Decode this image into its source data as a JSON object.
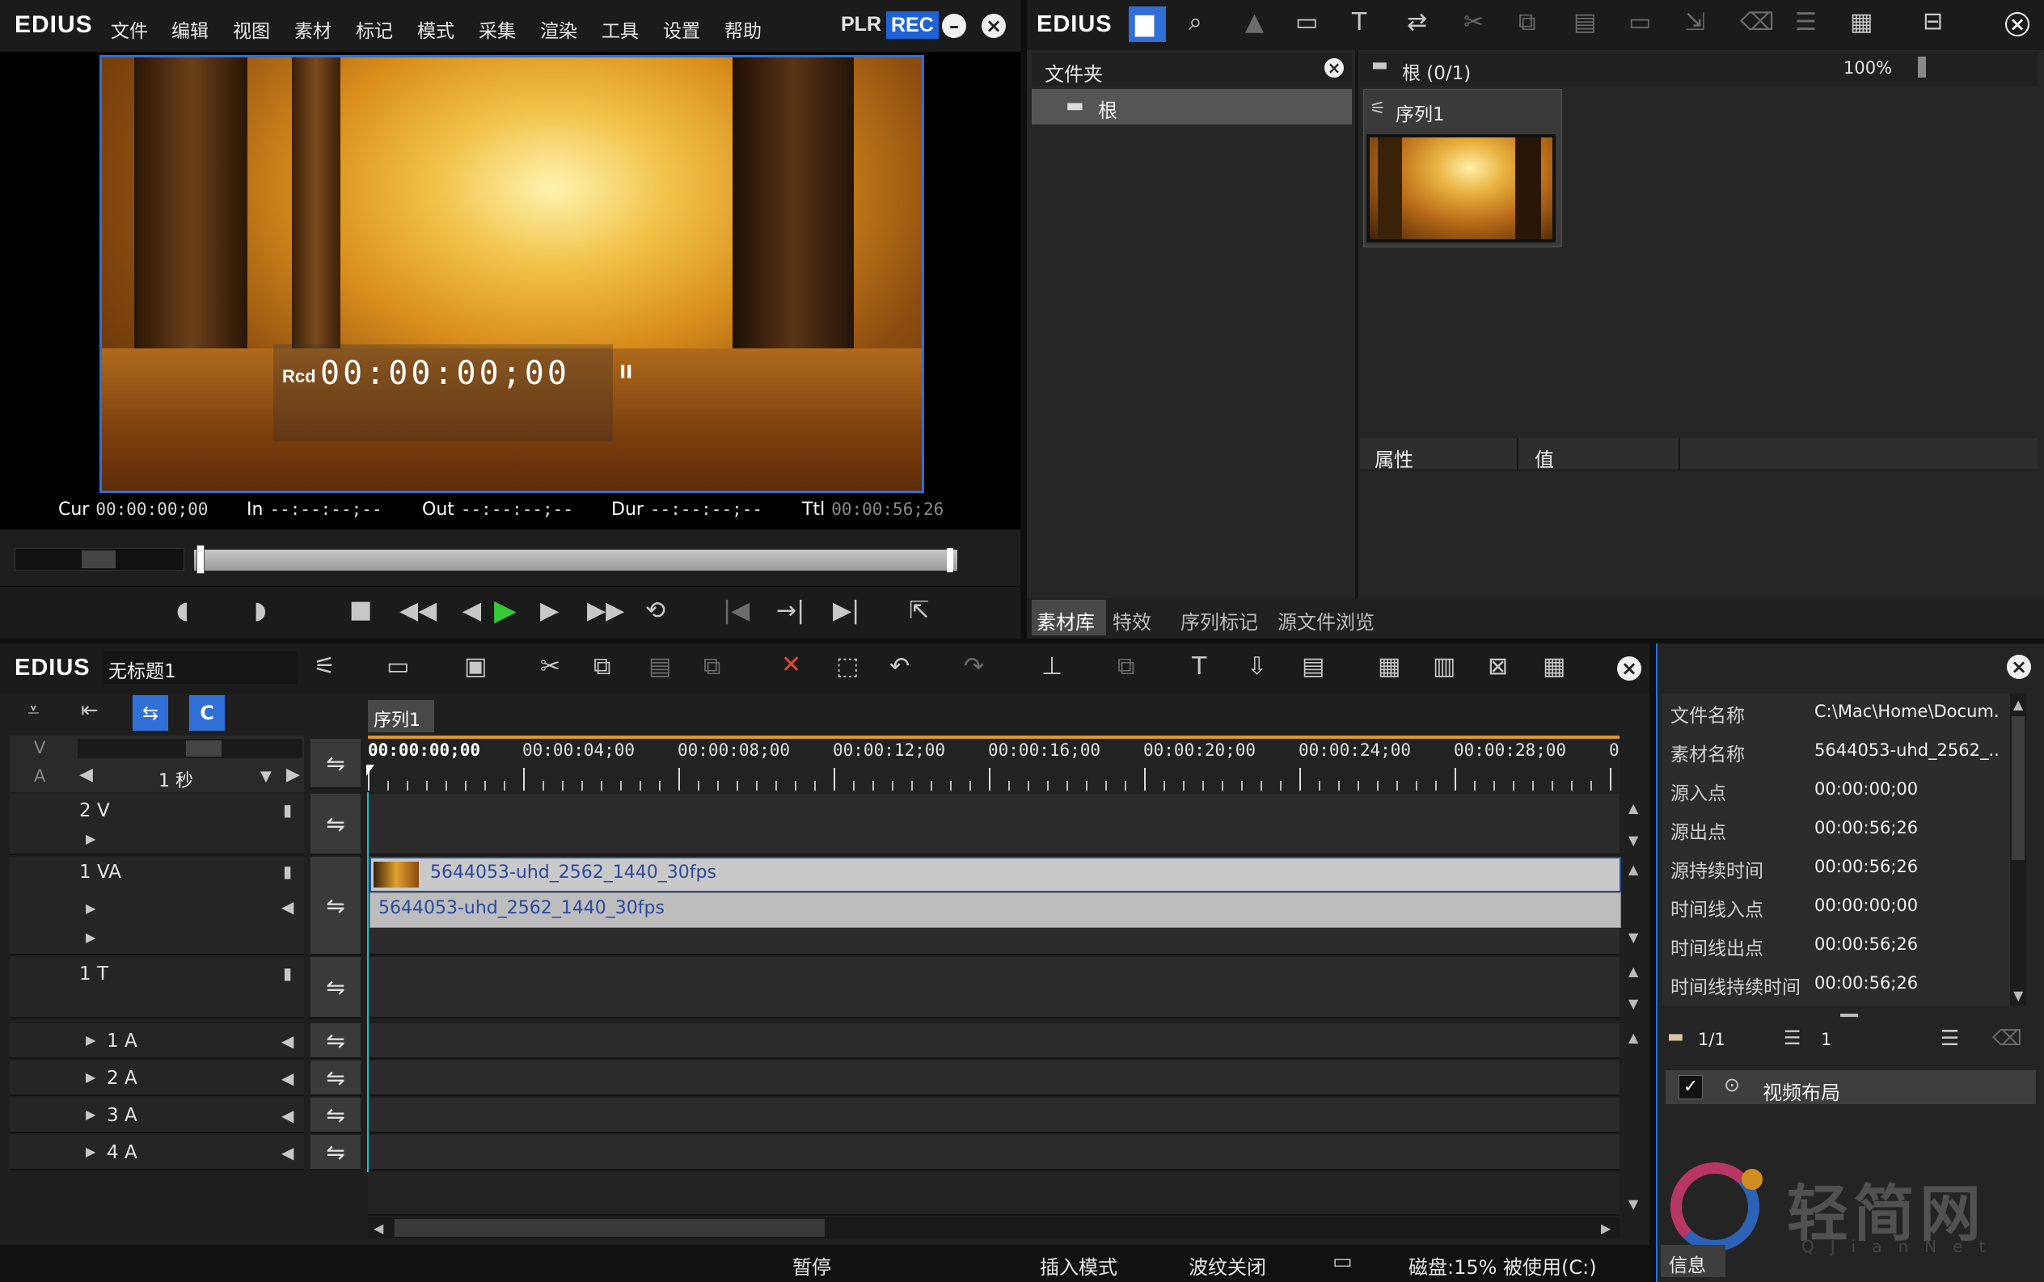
{
  "player": {
    "brand": "EDIUS",
    "menu": [
      "文件",
      "编辑",
      "视图",
      "素材",
      "标记",
      "模式",
      "采集",
      "渲染",
      "工具",
      "设置",
      "帮助"
    ],
    "plr": "PLR",
    "rec": "REC",
    "overlay_prefix": "Rcd",
    "overlay_timecode": "00:00:00;00",
    "overlay_pause": "II",
    "timecodes": {
      "cur_label": "Cur",
      "cur": "00:00:00;00",
      "in_label": "In",
      "in": "--:--:--;--",
      "out_label": "Out",
      "out": "--:--:--;--",
      "dur_label": "Dur",
      "dur": "--:--:--;--",
      "ttl_label": "Ttl",
      "ttl": "00:00:56;26"
    }
  },
  "bin": {
    "brand": "EDIUS",
    "folder_header": "文件夹",
    "root_folder": "根",
    "path": "根 (0/1)",
    "zoom": "100%",
    "clip_name": "序列1",
    "prop_header": "属性",
    "value_header": "值",
    "tabs": [
      "素材库",
      "特效",
      "序列标记",
      "源文件浏览"
    ]
  },
  "timeline": {
    "brand": "EDIUS",
    "project_title": "无标题1",
    "sequence_tab": "序列1",
    "scale": "1 秒",
    "v_label": "V",
    "a_label": "A",
    "ruler": [
      "00:00:00;00",
      "00:00:04;00",
      "00:00:08;00",
      "00:00:12;00",
      "00:00:16;00",
      "00:00:20;00",
      "00:00:24;00",
      "00:00:28;00",
      "0"
    ],
    "tracks": [
      "2 V",
      "1 VA",
      "1 T",
      "1 A",
      "2 A",
      "3 A",
      "4 A"
    ],
    "clip_video": "5644053-uhd_2562_1440_30fps",
    "clip_audio": "5644053-uhd_2562_1440_30fps"
  },
  "info": {
    "rows": [
      {
        "key": "文件名称",
        "value": "C:\\Mac\\Home\\Docum..."
      },
      {
        "key": "素材名称",
        "value": "5644053-uhd_2562_..."
      },
      {
        "key": "源入点",
        "value": "00:00:00;00"
      },
      {
        "key": "源出点",
        "value": "00:00:56;26"
      },
      {
        "key": "源持续时间",
        "value": "00:00:56;26"
      },
      {
        "key": "时间线入点",
        "value": "00:00:00;00"
      },
      {
        "key": "时间线出点",
        "value": "00:00:56;26"
      },
      {
        "key": "时间线持续时间",
        "value": "00:00:56;26"
      }
    ],
    "page": "1/1",
    "layer_count": "1",
    "layout_item": "视频布局",
    "tab": "信息"
  },
  "status": {
    "state": "暂停",
    "mode": "插入模式",
    "ripple": "波纹关闭",
    "disk": "磁盘:15% 被使用(C:)"
  },
  "watermark": {
    "text": "轻简网",
    "sub": "QJianNet"
  },
  "colors": {
    "accent_blue": "#2f6fd6",
    "rec_blue": "#1e63d6",
    "play_green": "#37c837",
    "ruler_orange": "#d89a2a",
    "clip_blue": "#2d4e8e"
  }
}
